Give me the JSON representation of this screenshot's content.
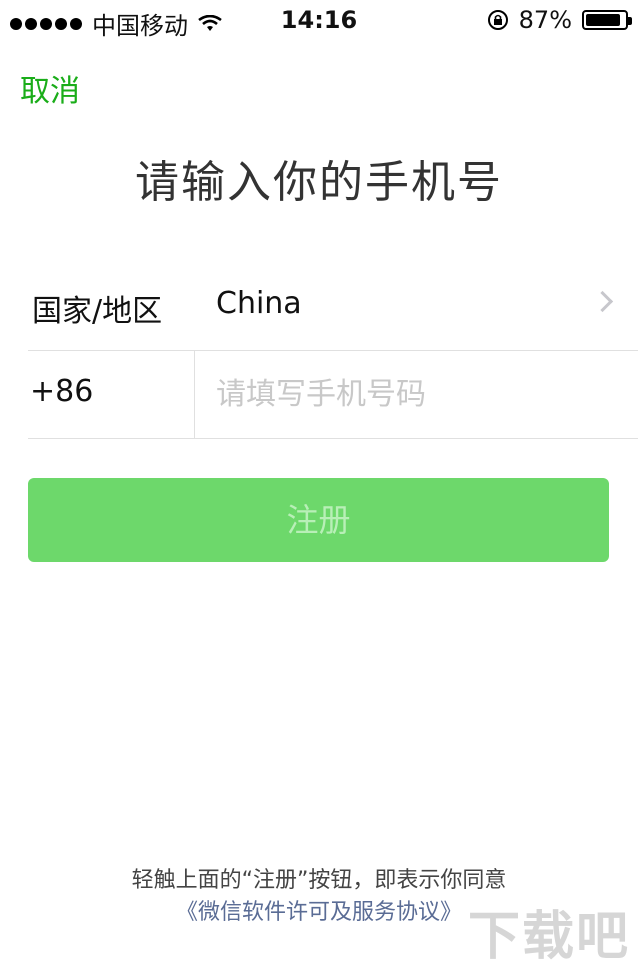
{
  "status_bar": {
    "carrier": "中国移动",
    "time": "14:16",
    "battery_percent": "87%",
    "battery_level": 0.87
  },
  "nav": {
    "cancel_label": "取消"
  },
  "title": "请输入你的手机号",
  "country_row": {
    "label": "国家/地区",
    "value": "China"
  },
  "phone_row": {
    "country_code": "+86",
    "placeholder": "请填写手机号码",
    "value": ""
  },
  "register_button": {
    "label": "注册",
    "color": "#6dd86b"
  },
  "footer": {
    "agreement_text": "轻触上面的“注册”按钮，即表示你同意",
    "agreement_link": "《微信软件许可及服务协议》"
  },
  "watermark": "下载吧",
  "colors": {
    "accent": "#1aad19",
    "link": "#5a6c95"
  }
}
